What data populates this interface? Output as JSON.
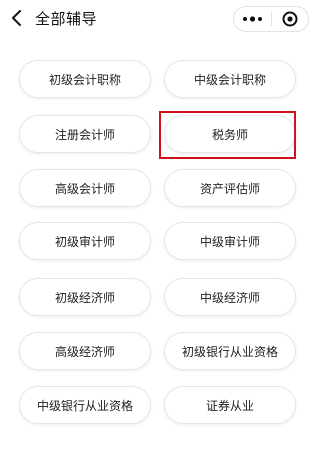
{
  "navbar": {
    "title": "全部辅导",
    "back_icon": "chevron-left-icon",
    "more_icon": "more-dots-icon",
    "close_icon": "target-circle-icon"
  },
  "items": [
    "初级会计职称",
    "中级会计职称",
    "注册会计师",
    "税务师",
    "高级会计师",
    "资产评估师",
    "初级审计师",
    "中级审计师",
    "初级经济师",
    "中级经济师",
    "高级经济师",
    "初级银行从业资格",
    "中级银行从业资格",
    "证券从业"
  ],
  "highlight_color": "#d0111b"
}
